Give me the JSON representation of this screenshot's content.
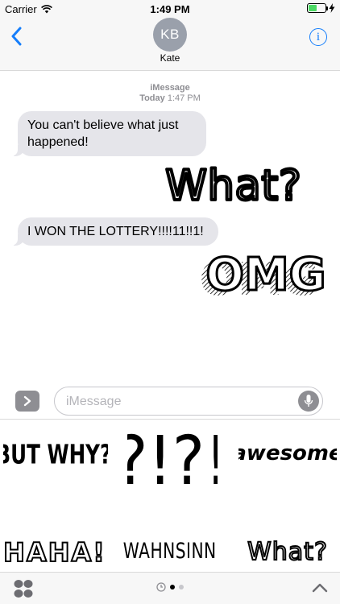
{
  "status_bar": {
    "carrier": "Carrier",
    "time": "1:49 PM",
    "battery_level": 0.5
  },
  "header": {
    "avatar_initials": "KB",
    "contact_name": "Kate",
    "back_icon": "chevron-left-icon",
    "info_icon": "info-icon"
  },
  "conversation": {
    "service": "iMessage",
    "day": "Today",
    "time": "1:47 PM",
    "messages": [
      {
        "type": "text",
        "text": "You can't believe what just happened!"
      },
      {
        "type": "sticker",
        "text": "What?"
      },
      {
        "type": "text",
        "text": "I WON THE LOTTERY!!!!11!!1!"
      },
      {
        "type": "sticker",
        "text": "OMG"
      }
    ]
  },
  "input": {
    "placeholder": "iMessage"
  },
  "sticker_drawer": {
    "stickers": [
      "BUT WHY?",
      "?!?!",
      "awesome",
      "HAHA!",
      "WAHNSINN",
      "What?"
    ]
  },
  "bottom_bar": {
    "page_count": 3,
    "current_page": 1
  },
  "colors": {
    "accent": "#157efb",
    "bubble_gray": "#e5e5ea",
    "battery_green": "#4cd964"
  }
}
